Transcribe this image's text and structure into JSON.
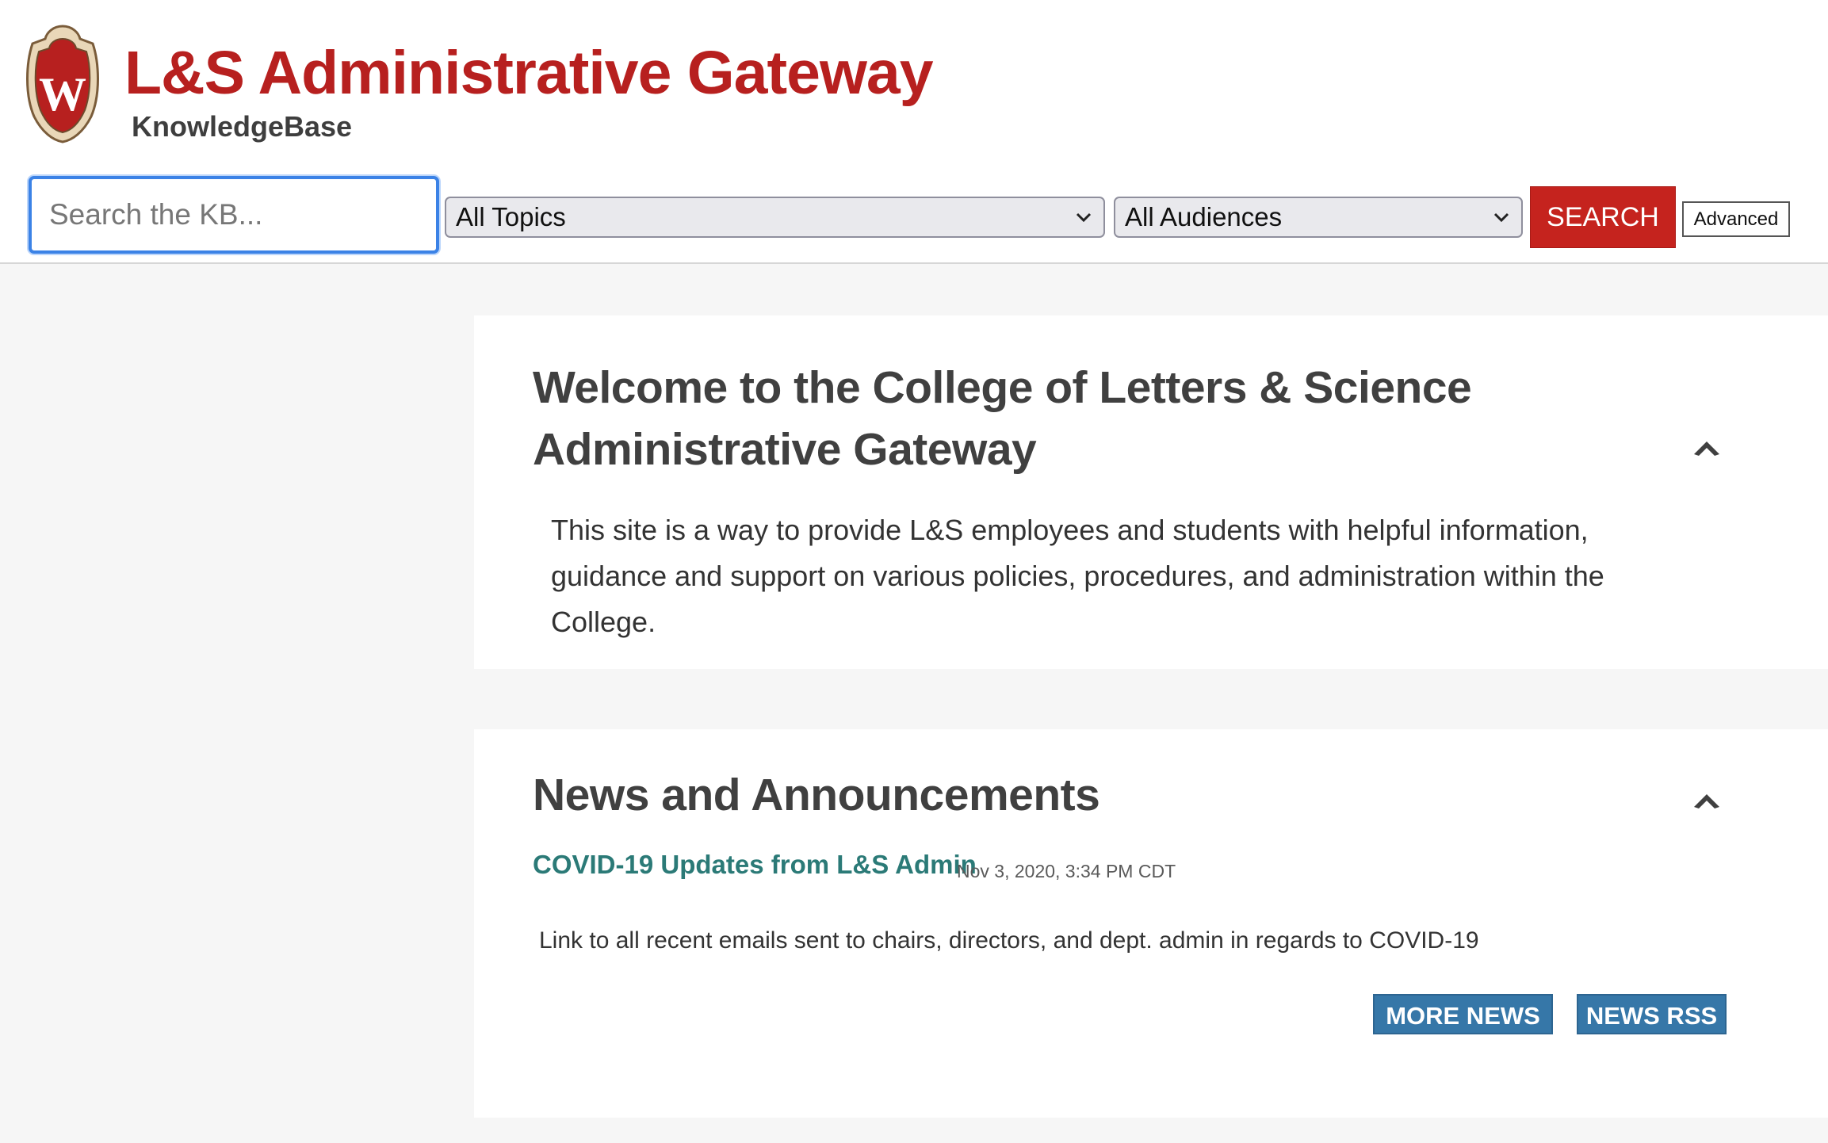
{
  "header": {
    "title": "L&S Administrative Gateway",
    "subtitle": "KnowledgeBase",
    "logo_icon": "uw-crest-icon",
    "brand_color": "#b7201f"
  },
  "search": {
    "placeholder": "Search the KB...",
    "value": "",
    "topics_selected": "All Topics",
    "audiences_selected": "All Audiences",
    "search_label": "SEARCH",
    "advanced_label": "Advanced"
  },
  "welcome": {
    "heading": "Welcome to the College of Letters & Science Administrative Gateway",
    "body": "This site is a way to provide L&S employees and students with helpful information, guidance and support on various policies, procedures, and administration within the College."
  },
  "news": {
    "heading": "News and Announcements",
    "items": [
      {
        "title": "COVID-19 Updates from L&S Admin",
        "date": "Nov 3, 2020, 3:34 PM CDT",
        "summary": "Link to all recent emails sent to chairs, directors, and dept. admin in regards to COVID-19"
      }
    ],
    "more_label": "MORE NEWS",
    "rss_label": "NEWS RSS",
    "link_color": "#2b7a77",
    "button_color": "#3677a8"
  }
}
